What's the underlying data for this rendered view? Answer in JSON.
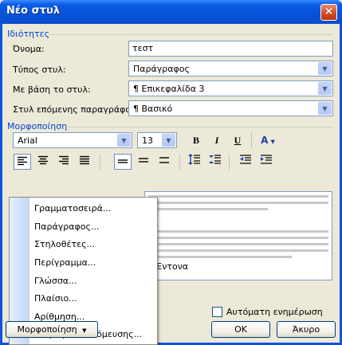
{
  "window": {
    "title": "Νέο στυλ"
  },
  "properties": {
    "section_label": "Ιδιότητες",
    "name_label": "Όνομα:",
    "name_value": "τεστ",
    "style_type_label": "Τύπος στυλ:",
    "style_type_value": "Παράγραφος",
    "based_on_label": "Με βάση το στυλ:",
    "based_on_value": "¶ Επικεφαλίδα 3",
    "next_para_label": "Στυλ επόμενης παραγράφου:",
    "next_para_value": "¶ Βασικό"
  },
  "formatting": {
    "section_label": "Μορφοποίηση",
    "font_name": "Arial",
    "font_size": "13",
    "bold": "B",
    "italic": "I",
    "underline": "U",
    "font_color_glyph": "A",
    "preview_note": "Έντονα"
  },
  "menu": {
    "items": [
      {
        "label": "Γραμματοσειρά..."
      },
      {
        "label": "Παράγραφος..."
      },
      {
        "label": "Στηλοθέτες..."
      },
      {
        "label": "Περίγραμμα..."
      },
      {
        "label": "Γλώσσα..."
      },
      {
        "label": "Πλαίσιο..."
      },
      {
        "label": "Αρίθμηση..."
      },
      {
        "label": "Πλήκτρο συντόμευσης..."
      }
    ]
  },
  "footer": {
    "format_button": "Μορφοποίηση",
    "auto_update_label": "Αυτόματη ενημέρωση",
    "ok_button": "OK",
    "cancel_button": "Άκυρο"
  },
  "icons": {
    "close": "close-icon",
    "dropdown": "chevron-down-icon",
    "align": [
      "align-left-icon",
      "align-center-icon",
      "align-right-icon",
      "align-justify-icon"
    ],
    "spacing": [
      "single-spacing-icon",
      "one-half-spacing-icon",
      "double-spacing-icon"
    ],
    "para_spacing": [
      "increase-spacing-icon",
      "decrease-spacing-icon"
    ],
    "indent": [
      "decrease-indent-icon",
      "increase-indent-icon"
    ]
  }
}
